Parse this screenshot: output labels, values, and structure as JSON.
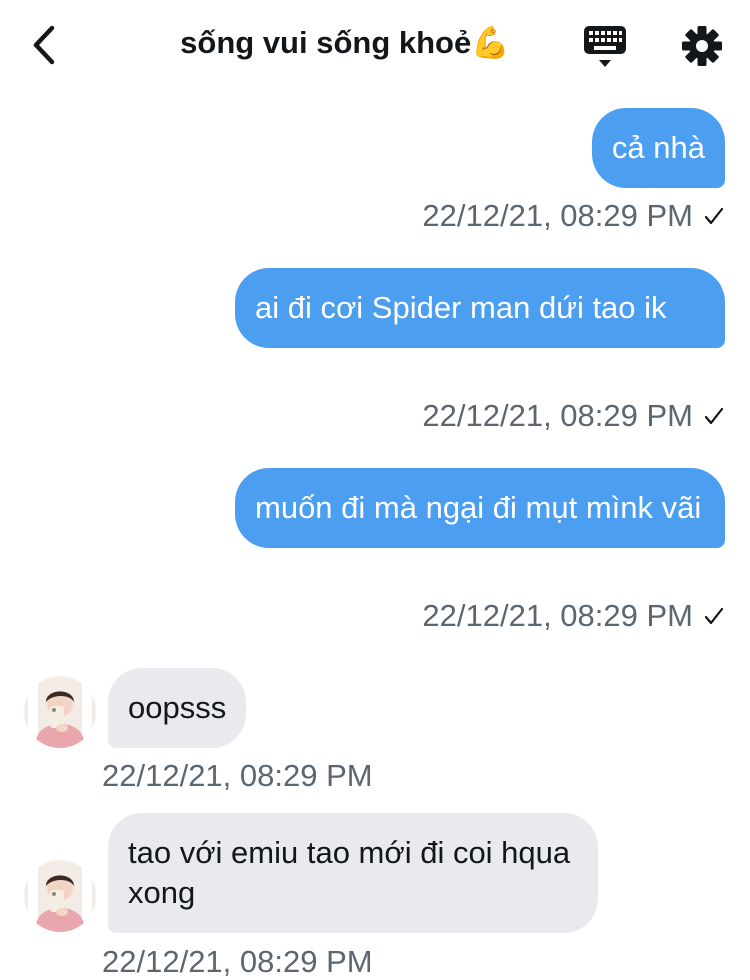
{
  "header": {
    "title": "sống vui sống khoẻ💪"
  },
  "messages": [
    {
      "direction": "out",
      "text": "cả nhà",
      "time": "22/12/21, 08:29 PM"
    },
    {
      "direction": "out",
      "text": "ai đi cơi Spider man dứi tao ik",
      "time": "22/12/21, 08:29 PM"
    },
    {
      "direction": "out",
      "text": "muốn đi mà ngại đi mụt mìnk vãi",
      "time": "22/12/21, 08:29 PM"
    },
    {
      "direction": "in",
      "text": "oopsss",
      "time": "22/12/21, 08:29 PM"
    },
    {
      "direction": "in",
      "text": "tao với emiu tao mới đi coi hqua xong",
      "time": "22/12/21, 08:29 PM"
    }
  ],
  "colors": {
    "outgoing_bubble": "#4c9ef0",
    "incoming_bubble": "#e8eaed",
    "timestamp": "#5b6670"
  },
  "icons": {
    "back": "chevron-left-icon",
    "keyboard": "keyboard-icon",
    "settings": "gear-icon",
    "read": "checkmark-icon"
  }
}
